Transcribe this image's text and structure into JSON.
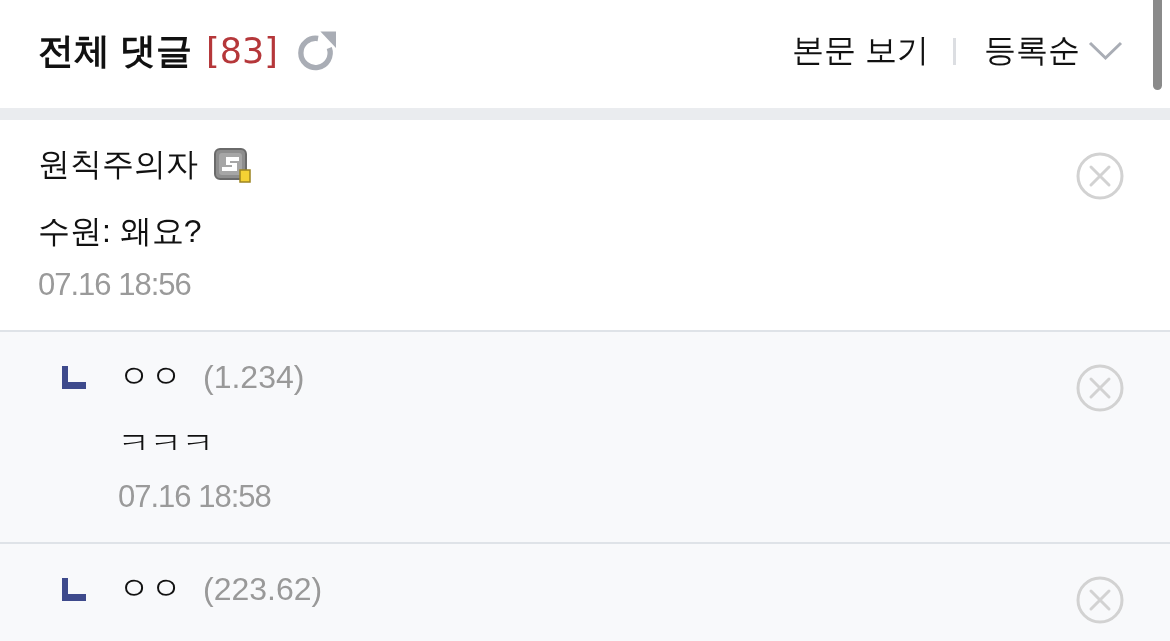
{
  "header": {
    "title": "전체 댓글",
    "count": "[83]",
    "view_post_link": "본문 보기",
    "sort_dropdown": {
      "label": "등록순"
    }
  },
  "comments": [
    {
      "kind": "comment",
      "author": "원칙주의자",
      "badge": true,
      "text": "수원: 왜요?",
      "time": "07.16 18:56"
    },
    {
      "kind": "reply",
      "author": "ㅇㅇ",
      "badge": false,
      "ip": "(1.234)",
      "text": "ㅋㅋㅋ",
      "time": "07.16 18:58"
    },
    {
      "kind": "reply",
      "author": "ㅇㅇ",
      "badge": false,
      "ip": "(223.62)"
    }
  ]
}
